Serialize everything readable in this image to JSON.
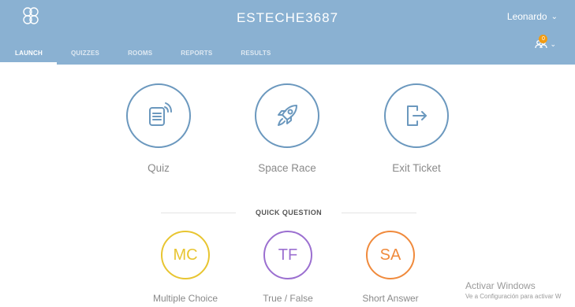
{
  "header": {
    "room_name": "ESTECHE3687",
    "user_name": "Leonardo",
    "notification_count": "0",
    "background_color": "#8ab1d2"
  },
  "tabs": [
    {
      "label": "LAUNCH",
      "active": true
    },
    {
      "label": "QUIZZES"
    },
    {
      "label": "ROOMS"
    },
    {
      "label": "REPORTS"
    },
    {
      "label": "RESULTS"
    }
  ],
  "activities": [
    {
      "label": "Quiz",
      "icon": "quiz-document-icon"
    },
    {
      "label": "Space Race",
      "icon": "rocket-icon"
    },
    {
      "label": "Exit Ticket",
      "icon": "exit-door-icon"
    }
  ],
  "quick_question": {
    "heading": "QUICK QUESTION",
    "options": [
      {
        "code": "MC",
        "label": "Multiple Choice",
        "color": "#e8c531"
      },
      {
        "code": "TF",
        "label": "True / False",
        "color": "#9b6fd0"
      },
      {
        "code": "SA",
        "label": "Short Answer",
        "color": "#f08a3c"
      }
    ]
  },
  "watermark": {
    "line1": "Activar Windows",
    "line2": "Ve a Configuración para activar W"
  },
  "colors": {
    "accent": "#6b98be"
  }
}
